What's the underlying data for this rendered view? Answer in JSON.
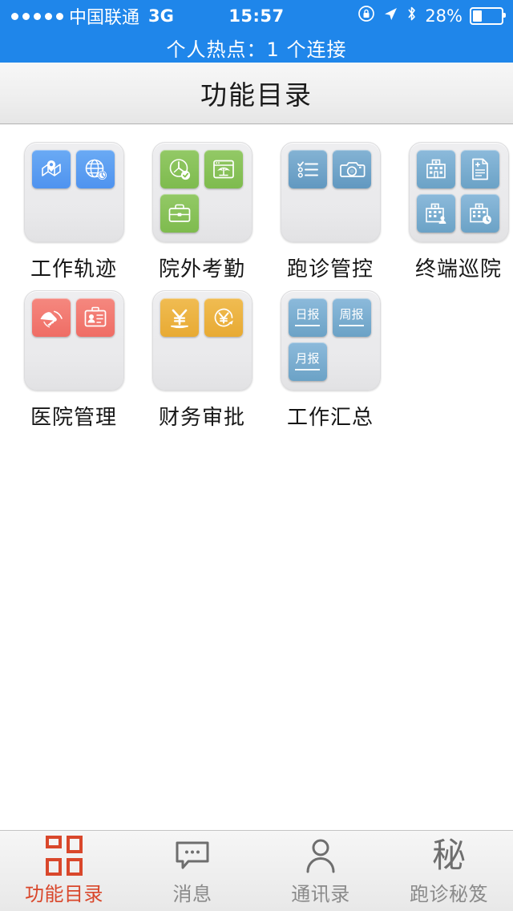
{
  "status_bar": {
    "signal_dots": 5,
    "carrier": "中国联通",
    "network": "3G",
    "time": "15:57",
    "battery_percent": "28%",
    "icons": [
      "rotation-lock-icon",
      "location-arrow-icon",
      "bluetooth-icon",
      "battery-icon"
    ]
  },
  "hotspot_banner": {
    "text": "个人热点：1 个连接",
    "background": "#1f86ea"
  },
  "navbar": {
    "title": "功能目录"
  },
  "folders": [
    {
      "label": "工作轨迹",
      "color": "#4f93ef",
      "apps": [
        {
          "icon": "map-pin-icon",
          "color_class": "c-blue"
        },
        {
          "icon": "globe-clock-icon",
          "color_class": "c-blue"
        }
      ]
    },
    {
      "label": "院外考勤",
      "color": "#7ebb4e",
      "apps": [
        {
          "icon": "clock-check-icon",
          "color_class": "c-green"
        },
        {
          "icon": "window-palm-icon",
          "color_class": "c-green"
        },
        {
          "icon": "briefcase-icon",
          "color_class": "c-green"
        }
      ]
    },
    {
      "label": "跑诊管控",
      "color": "#6198c0",
      "apps": [
        {
          "icon": "checklist-icon",
          "color_class": "c-steel"
        },
        {
          "icon": "camera-icon",
          "color_class": "c-steel"
        }
      ]
    },
    {
      "label": "终端巡院",
      "color": "#6198c0",
      "apps": [
        {
          "icon": "hospital-icon",
          "color_class": "c-steel2"
        },
        {
          "icon": "medical-document-icon",
          "color_class": "c-steel2"
        },
        {
          "icon": "hospital-person-icon",
          "color_class": "c-steel2"
        },
        {
          "icon": "hospital-clock-icon",
          "color_class": "c-steel2"
        }
      ]
    },
    {
      "label": "医院管理",
      "color": "#ef6d65",
      "apps": [
        {
          "icon": "handshake-icon",
          "color_class": "c-red"
        },
        {
          "icon": "id-card-icon",
          "color_class": "c-red"
        }
      ]
    },
    {
      "label": "财务审批",
      "color": "#e8aa33",
      "apps": [
        {
          "icon": "yuan-payment-icon",
          "color_class": "c-orange"
        },
        {
          "icon": "yuan-refund-icon",
          "color_class": "c-orange"
        }
      ]
    },
    {
      "label": "工作汇总",
      "color": "#6ba2c6",
      "apps": [
        {
          "icon": "daily-report-icon",
          "color_class": "c-steel2",
          "text": "日报"
        },
        {
          "icon": "weekly-report-icon",
          "color_class": "c-steel2",
          "text": "周报"
        },
        {
          "icon": "monthly-report-icon",
          "color_class": "c-steel2",
          "text": "月报"
        }
      ]
    }
  ],
  "tabbar": {
    "active_color": "#d9472b",
    "inactive_color": "#8a8a8a",
    "tabs": [
      {
        "label": "功能目录",
        "icon": "grid-icon",
        "active": true
      },
      {
        "label": "消息",
        "icon": "chat-bubble-icon",
        "active": false
      },
      {
        "label": "通讯录",
        "icon": "person-icon",
        "active": false
      },
      {
        "label": "跑诊秘笈",
        "icon": "mi-character-icon",
        "active": false,
        "glyph": "秘"
      }
    ]
  }
}
